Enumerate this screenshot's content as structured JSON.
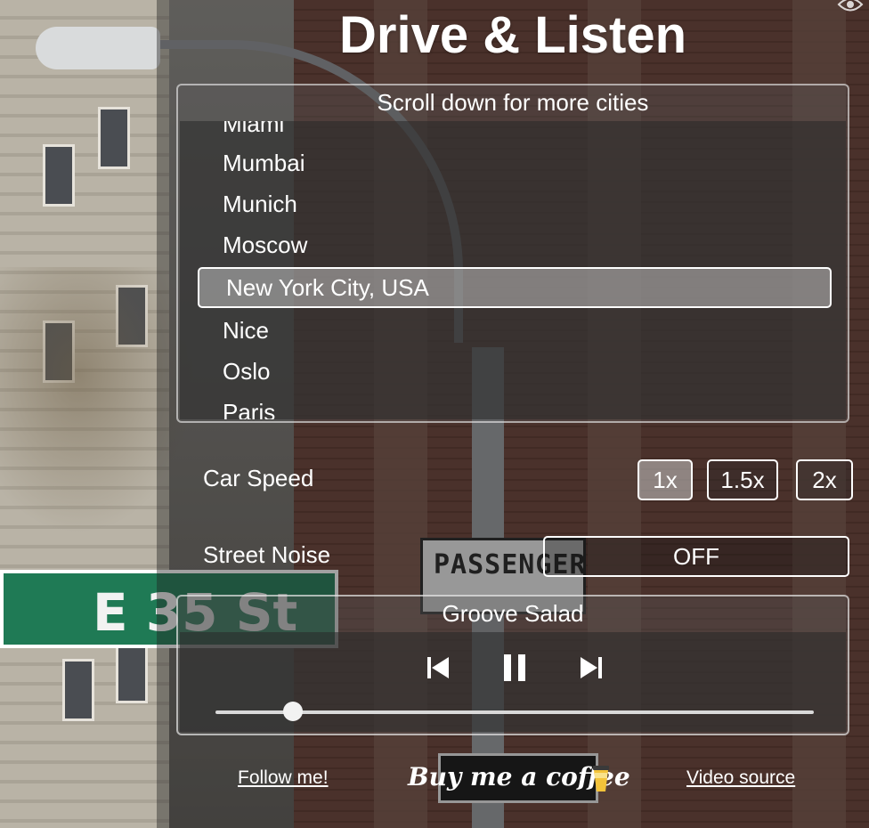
{
  "app": {
    "title": "Drive & Listen"
  },
  "cities": {
    "header": "Scroll down for more cities",
    "items": [
      "Miami",
      "Mumbai",
      "Munich",
      "Moscow",
      "New York City, USA",
      "Nice",
      "Oslo",
      "Paris"
    ],
    "selected": "New York City, USA"
  },
  "car_speed": {
    "label": "Car Speed",
    "options": [
      "1x",
      "1.5x",
      "2x"
    ],
    "selected": "1x"
  },
  "street_noise": {
    "label": "Street Noise",
    "value": "OFF"
  },
  "player": {
    "station": "Groove Salad",
    "icons": {
      "prev": "skip-previous-icon",
      "pause": "pause-icon",
      "next": "skip-next-icon"
    },
    "volume_fraction": 0.13
  },
  "footer": {
    "follow": "Follow me!",
    "coffee": "Buy me a coffee",
    "video_source": "Video source"
  },
  "background_signs": {
    "street": "E 35 St",
    "passenger": "PASSENGER"
  },
  "colors": {
    "selected_bg": "#c8c8c8",
    "accent": "#ffffff",
    "street_sign": "#1f7a55"
  }
}
